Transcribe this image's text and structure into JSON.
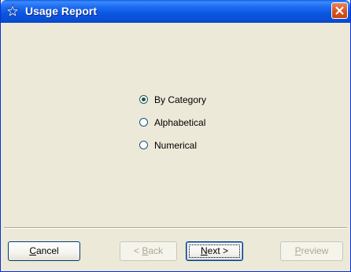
{
  "window": {
    "title": "Usage Report",
    "icon": "star-outline-icon"
  },
  "options": [
    {
      "label": "By Category",
      "checked": true
    },
    {
      "label": "Alphabetical",
      "checked": false
    },
    {
      "label": "Numerical",
      "checked": false
    }
  ],
  "buttons": {
    "cancel": {
      "mnemonic": "C",
      "rest": "ancel",
      "enabled": true
    },
    "back": {
      "prefix": "< ",
      "mnemonic": "B",
      "rest": "ack",
      "enabled": false
    },
    "next": {
      "mnemonic": "N",
      "rest": "ext >",
      "enabled": true
    },
    "preview": {
      "mnemonic": "P",
      "rest": "review",
      "enabled": false
    }
  },
  "colors": {
    "titlebar": "#0a55e0",
    "dialog_bg": "#ece9d8",
    "close": "#d3511f"
  }
}
